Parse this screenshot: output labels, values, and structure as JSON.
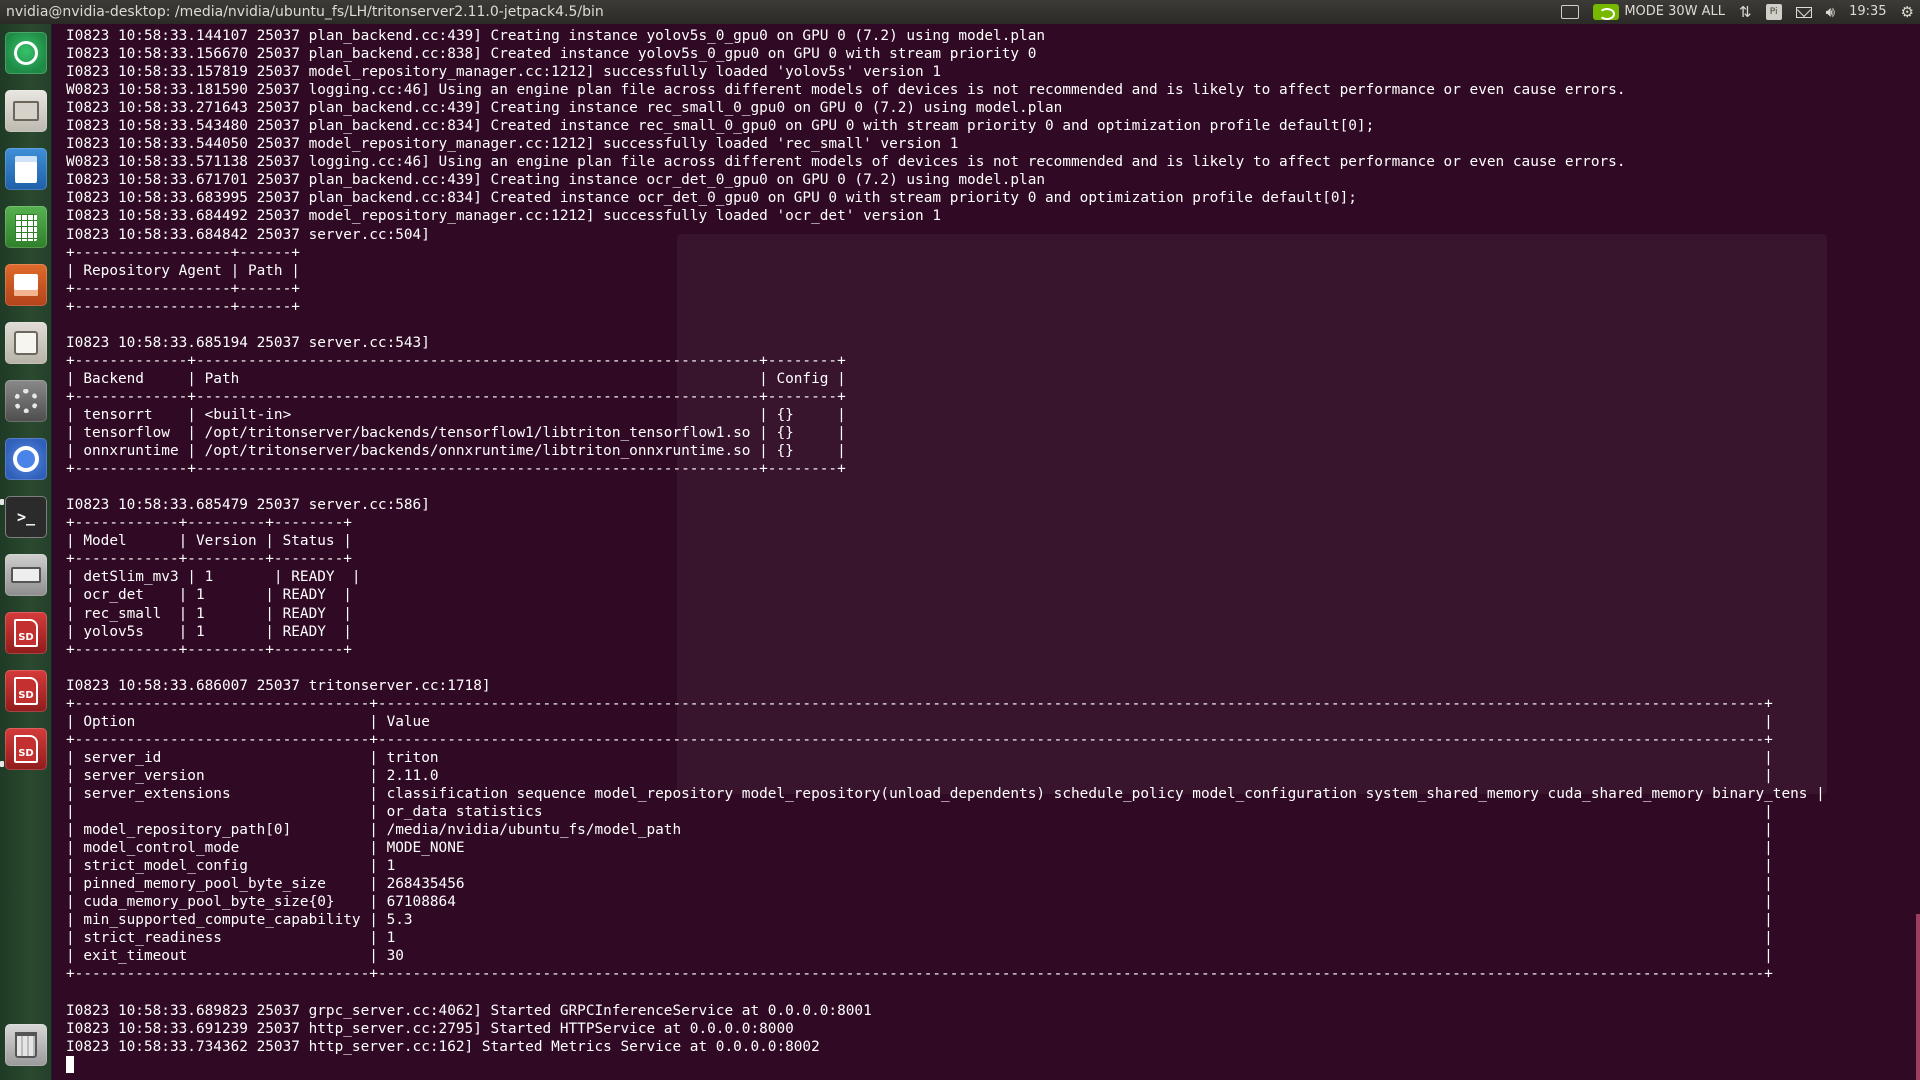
{
  "topbar": {
    "window_title": "nvidia@nvidia-desktop: /media/nvidia/ubuntu_fs/LH/tritonserver2.11.0-jetpack4.5/bin",
    "power_mode": "MODE 30W ALL",
    "keyboard_indicator": "Pi",
    "time": "19:35",
    "icons": [
      "app-indicator-icon",
      "nvidia-icon",
      "network-icon",
      "keyboard-icon",
      "mail-icon",
      "volume-icon",
      "gear-icon"
    ]
  },
  "launcher": {
    "items": [
      {
        "name": "dash-home",
        "icon": "ubuntu-dash-icon"
      },
      {
        "name": "files",
        "icon": "files-icon"
      },
      {
        "name": "libreoffice-writer",
        "icon": "writer-icon"
      },
      {
        "name": "libreoffice-calc",
        "icon": "calc-icon"
      },
      {
        "name": "libreoffice-impress",
        "icon": "impress-icon"
      },
      {
        "name": "software-center",
        "icon": "store-icon"
      },
      {
        "name": "system-settings",
        "icon": "settings-icon"
      },
      {
        "name": "chromium",
        "icon": "chromium-icon"
      },
      {
        "name": "terminal",
        "icon": "terminal-icon"
      },
      {
        "name": "drive",
        "icon": "drive-icon"
      },
      {
        "name": "sd-card-1",
        "icon": "sd-card-icon",
        "label": "SD"
      },
      {
        "name": "sd-card-2",
        "icon": "sd-card-icon",
        "label": "SD"
      },
      {
        "name": "sd-card-3",
        "icon": "sd-card-icon",
        "label": "SD"
      },
      {
        "name": "trash",
        "icon": "trash-icon"
      }
    ]
  },
  "terminal": {
    "lines": [
      "I0823 10:58:33.144107 25037 plan_backend.cc:439] Creating instance yolov5s_0_gpu0 on GPU 0 (7.2) using model.plan",
      "I0823 10:58:33.156670 25037 plan_backend.cc:838] Created instance yolov5s_0_gpu0 on GPU 0 with stream priority 0",
      "I0823 10:58:33.157819 25037 model_repository_manager.cc:1212] successfully loaded 'yolov5s' version 1",
      "W0823 10:58:33.181590 25037 logging.cc:46] Using an engine plan file across different models of devices is not recommended and is likely to affect performance or even cause errors.",
      "I0823 10:58:33.271643 25037 plan_backend.cc:439] Creating instance rec_small_0_gpu0 on GPU 0 (7.2) using model.plan",
      "I0823 10:58:33.543480 25037 plan_backend.cc:834] Created instance rec_small_0_gpu0 on GPU 0 with stream priority 0 and optimization profile default[0];",
      "I0823 10:58:33.544050 25037 model_repository_manager.cc:1212] successfully loaded 'rec_small' version 1",
      "W0823 10:58:33.571138 25037 logging.cc:46] Using an engine plan file across different models of devices is not recommended and is likely to affect performance or even cause errors.",
      "I0823 10:58:33.671701 25037 plan_backend.cc:439] Creating instance ocr_det_0_gpu0 on GPU 0 (7.2) using model.plan",
      "I0823 10:58:33.683995 25037 plan_backend.cc:834] Created instance ocr_det_0_gpu0 on GPU 0 with stream priority 0 and optimization profile default[0];",
      "I0823 10:58:33.684492 25037 model_repository_manager.cc:1212] successfully loaded 'ocr_det' version 1",
      "I0823 10:58:33.684842 25037 server.cc:504]",
      "+------------------+------+",
      "| Repository Agent | Path |",
      "+------------------+------+",
      "+------------------+------+",
      "",
      "I0823 10:58:33.685194 25037 server.cc:543]",
      "+-------------+-----------------------------------------------------------------+--------+",
      "| Backend     | Path                                                            | Config |",
      "+-------------+-----------------------------------------------------------------+--------+",
      "| tensorrt    | <built-in>                                                      | {}     |",
      "| tensorflow  | /opt/tritonserver/backends/tensorflow1/libtriton_tensorflow1.so | {}     |",
      "| onnxruntime | /opt/tritonserver/backends/onnxruntime/libtriton_onnxruntime.so | {}     |",
      "+-------------+-----------------------------------------------------------------+--------+",
      "",
      "I0823 10:58:33.685479 25037 server.cc:586]",
      "+------------+---------+--------+",
      "| Model      | Version | Status |",
      "+------------+---------+--------+",
      "| detSlim_mv3 | 1       | READY  |",
      "| ocr_det    | 1       | READY  |",
      "| rec_small  | 1       | READY  |",
      "| yolov5s    | 1       | READY  |",
      "+------------+---------+--------+",
      "",
      "I0823 10:58:33.686007 25037 tritonserver.cc:1718]",
      "+----------------------------------+----------------------------------------------------------------------------------------------------------------------------------------------------------------+",
      "| Option                           | Value                                                                                                                                                          |",
      "+----------------------------------+----------------------------------------------------------------------------------------------------------------------------------------------------------------+",
      "| server_id                        | triton                                                                                                                                                         |",
      "| server_version                   | 2.11.0                                                                                                                                                         |",
      "| server_extensions                | classification sequence model_repository model_repository(unload_dependents) schedule_policy model_configuration system_shared_memory cuda_shared_memory binary_tens |",
      "|                                  | or_data statistics                                                                                                                                             |",
      "| model_repository_path[0]         | /media/nvidia/ubuntu_fs/model_path                                                                                                                             |",
      "| model_control_mode               | MODE_NONE                                                                                                                                                      |",
      "| strict_model_config              | 1                                                                                                                                                              |",
      "| pinned_memory_pool_byte_size     | 268435456                                                                                                                                                      |",
      "| cuda_memory_pool_byte_size{0}    | 67108864                                                                                                                                                       |",
      "| min_supported_compute_capability | 5.3                                                                                                                                                            |",
      "| strict_readiness                 | 1                                                                                                                                                              |",
      "| exit_timeout                     | 30                                                                                                                                                             |",
      "+----------------------------------+----------------------------------------------------------------------------------------------------------------------------------------------------------------+",
      "",
      "I0823 10:58:33.689823 25037 grpc_server.cc:4062] Started GRPCInferenceService at 0.0.0.0:8001",
      "I0823 10:58:33.691239 25037 http_server.cc:2795] Started HTTPService at 0.0.0.0:8000",
      "I0823 10:58:33.734362 25037 http_server.cc:162] Started Metrics Service at 0.0.0.0:8002"
    ]
  },
  "colors": {
    "terminal_bg": "#300a24",
    "terminal_fg": "#ffffff",
    "panel_bg": "#3c3b37",
    "launcher_bg": "#2a4a2f"
  }
}
